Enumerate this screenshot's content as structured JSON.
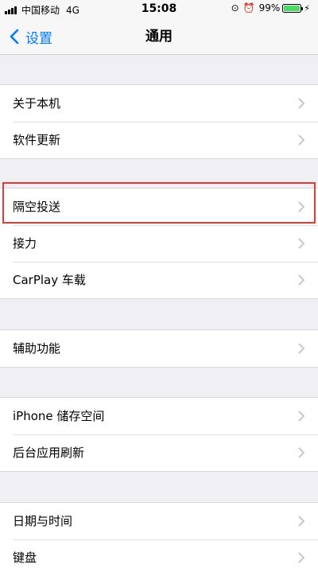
{
  "status_bar": {
    "carrier": "中国移动",
    "network": "4G",
    "time": "15:08",
    "battery": "99%",
    "battery_level": 0.99,
    "signal_bars": 4
  },
  "nav": {
    "back_label": "设置",
    "title": "通用"
  },
  "groups": [
    {
      "items": [
        {
          "label": "关于本机"
        },
        {
          "label": "软件更新"
        }
      ]
    },
    {
      "items": [
        {
          "label": "隔空投送"
        },
        {
          "label": "接力"
        },
        {
          "label": "CarPlay 车载"
        }
      ]
    },
    {
      "items": [
        {
          "label": "辅助功能"
        }
      ]
    },
    {
      "items": [
        {
          "label": "iPhone 储存空间"
        },
        {
          "label": "后台应用刷新"
        }
      ]
    },
    {
      "items": [
        {
          "label": "日期与时间"
        },
        {
          "label": "键盘"
        }
      ]
    }
  ],
  "highlighted_item": "隔空投送",
  "colors": {
    "accent": "#007aff",
    "highlight": "#e53935",
    "background": "#efeff4",
    "battery": "#4cd964"
  }
}
